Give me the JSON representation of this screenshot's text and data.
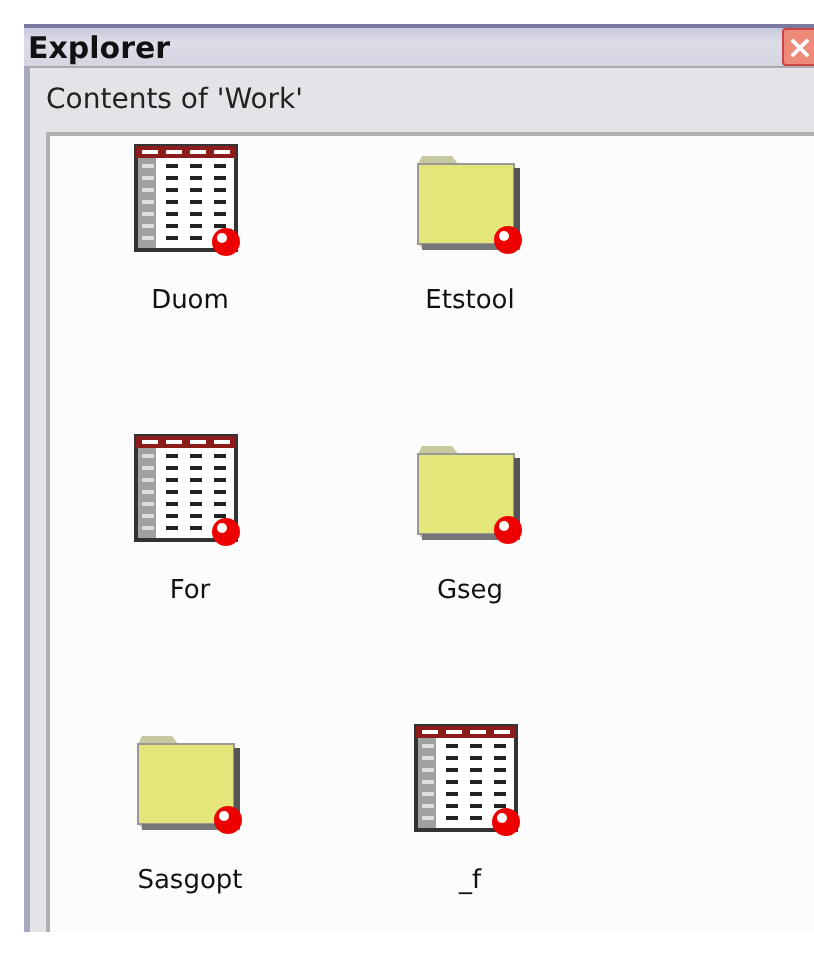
{
  "window": {
    "title": "Explorer",
    "close": "×"
  },
  "panel": {
    "label": "Contents of 'Work'"
  },
  "items": [
    {
      "kind": "table",
      "name": "Duom"
    },
    {
      "kind": "folder",
      "name": "Etstool"
    },
    {
      "kind": "table",
      "name": "For"
    },
    {
      "kind": "folder",
      "name": "Gseg"
    },
    {
      "kind": "folder",
      "name": "Sasgopt"
    },
    {
      "kind": "table",
      "name": "_f"
    }
  ]
}
